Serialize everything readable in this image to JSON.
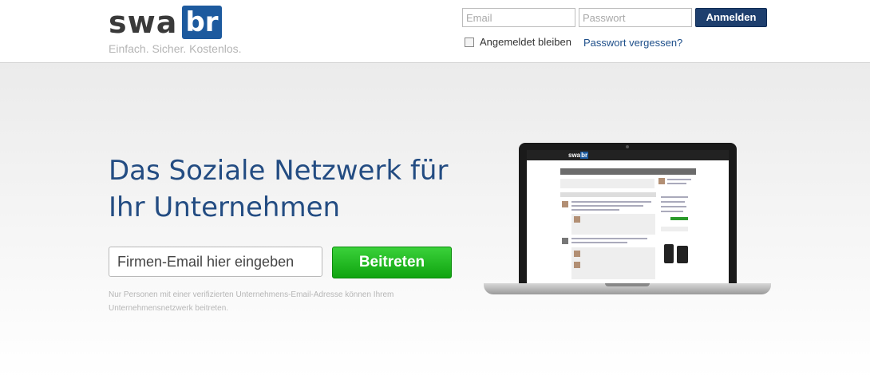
{
  "header": {
    "logo": {
      "left": "swa",
      "right": "br"
    },
    "tagline": "Einfach. Sicher. Kostenlos.",
    "login": {
      "email_placeholder": "Email",
      "password_placeholder": "Passwort",
      "button_label": "Anmelden",
      "remember_label": "Angemeldet bleiben",
      "forgot_label": "Passwort vergessen?"
    }
  },
  "hero": {
    "headline_line1": "Das Soziale Netzwerk für",
    "headline_line2": "Ihr Unternehmen",
    "email_placeholder": "Firmen-Email hier eingeben",
    "join_label": "Beitreten",
    "note": "Nur Personen mit einer verifizierten Unternehmens-Email-Adresse können Ihrem Unternehmensnetzwerk beitreten."
  },
  "colors": {
    "brand_blue": "#1d5a9e",
    "headline_blue": "#234c82",
    "login_button": "#1e3f6e",
    "join_green": "#18b318"
  }
}
